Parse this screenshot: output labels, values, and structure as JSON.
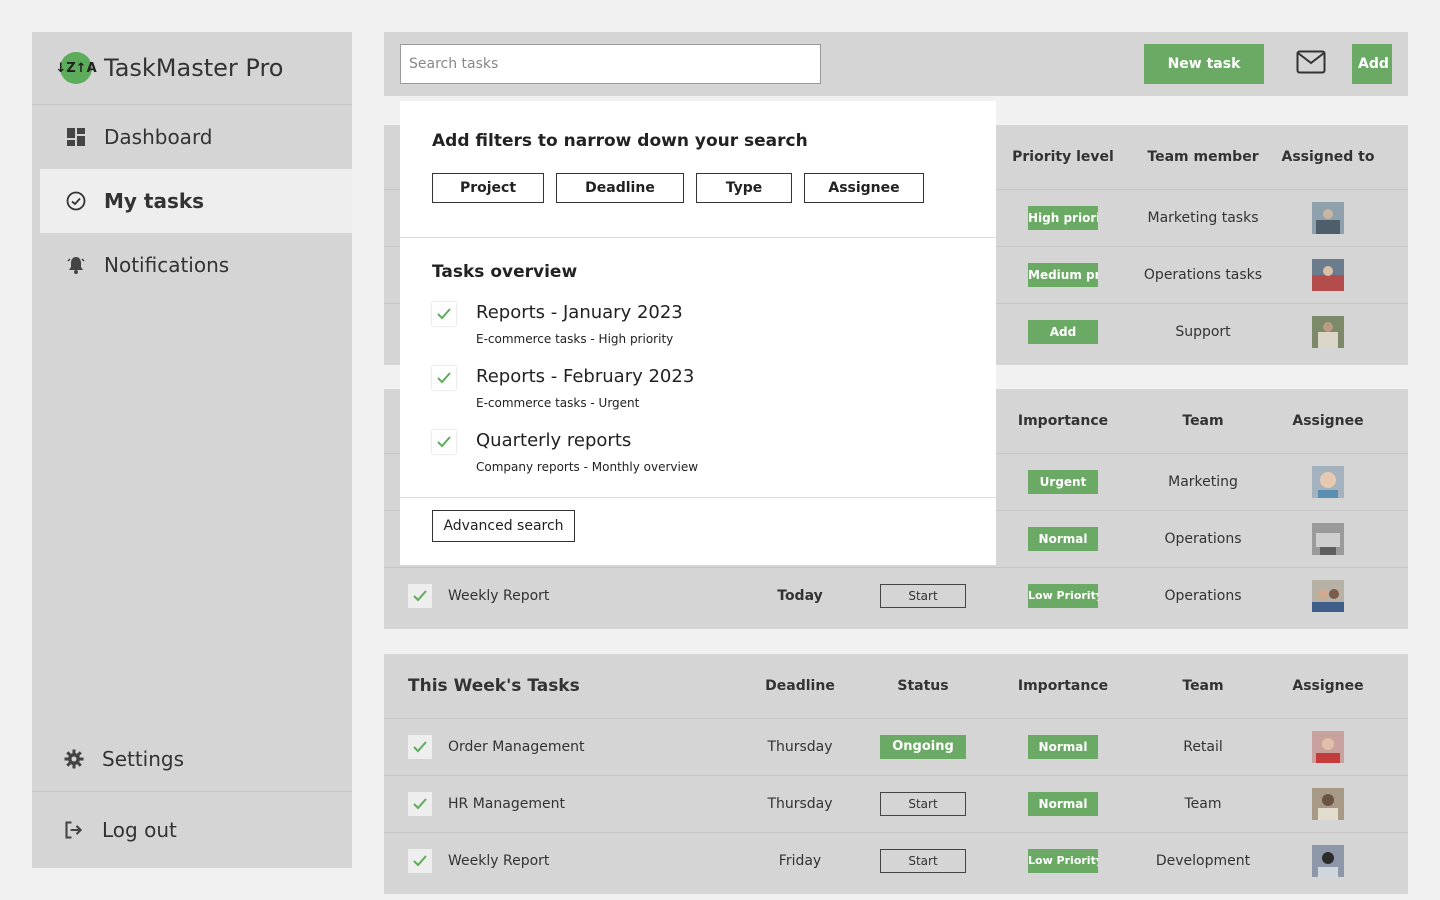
{
  "app": {
    "name": "TaskMaster Pro",
    "logo_text": "↓Z↑A"
  },
  "sidebar": {
    "items": [
      {
        "label": "Dashboard",
        "icon": "dashboard-icon"
      },
      {
        "label": "My tasks",
        "icon": "check-circle-icon"
      },
      {
        "label": "Notifications",
        "icon": "bell-icon"
      }
    ],
    "bottom": [
      {
        "label": "Settings",
        "icon": "gear-icon"
      },
      {
        "label": "Log out",
        "icon": "logout-icon"
      }
    ]
  },
  "topbar": {
    "search_placeholder": "Search tasks",
    "new_task_label": "New task",
    "add_label": "Add"
  },
  "colors": {
    "accent": "#6aaa64",
    "panel": "#d5d5d5",
    "background": "#f1f1f1"
  },
  "card1": {
    "headers": {
      "priority": "Priority level",
      "member": "Team member",
      "assigned": "Assigned to"
    },
    "rows": [
      {
        "priority": "High priority",
        "member": "Marketing tasks"
      },
      {
        "priority": "Medium priority",
        "member": "Operations tasks"
      },
      {
        "priority": "Add",
        "member": "Support"
      }
    ]
  },
  "card2": {
    "headers": {
      "importance": "Importance",
      "team": "Team",
      "assignee": "Assignee"
    },
    "rows": [
      {
        "importance": "Urgent",
        "team": "Marketing"
      },
      {
        "importance": "Normal",
        "team": "Operations"
      },
      {
        "name": "Weekly Report",
        "deadline": "Today",
        "status": "Start",
        "importance": "Low Priority",
        "team": "Operations"
      }
    ]
  },
  "card3": {
    "title": "This Week's Tasks",
    "headers": {
      "deadline": "Deadline",
      "status": "Status",
      "importance": "Importance",
      "team": "Team",
      "assignee": "Assignee"
    },
    "rows": [
      {
        "name": "Order Management",
        "deadline": "Thursday",
        "status": "Ongoing",
        "importance": "Normal",
        "team": "Retail"
      },
      {
        "name": "HR Management",
        "deadline": "Thursday",
        "status": "Start",
        "importance": "Normal",
        "team": "Team"
      },
      {
        "name": "Weekly Report",
        "deadline": "Friday",
        "status": "Start",
        "importance": "Low Priority",
        "team": "Development"
      }
    ]
  },
  "overlay": {
    "filters_title": "Add filters to narrow down your search",
    "filters": [
      "Project",
      "Deadline",
      "Type",
      "Assignee"
    ],
    "overview_title": "Tasks overview",
    "items": [
      {
        "title": "Reports - January 2023",
        "sub": "E-commerce tasks - High priority"
      },
      {
        "title": "Reports - February 2023",
        "sub": "E-commerce tasks - Urgent"
      },
      {
        "title": "Quarterly reports",
        "sub": "Company reports - Monthly overview"
      }
    ],
    "advanced_label": "Advanced search"
  }
}
